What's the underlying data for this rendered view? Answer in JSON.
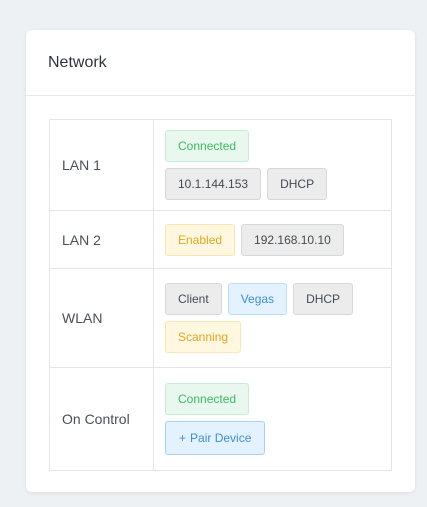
{
  "card": {
    "title": "Network"
  },
  "rows": [
    {
      "label": "LAN 1",
      "tags": [
        {
          "text": "Connected",
          "style": "success"
        },
        {
          "text": "10.1.144.153",
          "style": "default"
        },
        {
          "text": "DHCP",
          "style": "default"
        }
      ]
    },
    {
      "label": "LAN 2",
      "tags": [
        {
          "text": "Enabled",
          "style": "warning"
        },
        {
          "text": "192.168.10.10",
          "style": "default"
        }
      ]
    },
    {
      "label": "WLAN",
      "tags": [
        {
          "text": "Client",
          "style": "default"
        },
        {
          "text": "Vegas",
          "style": "info"
        },
        {
          "text": "DHCP",
          "style": "default"
        },
        {
          "text": "Scanning",
          "style": "warning"
        }
      ]
    },
    {
      "label": "On Control",
      "tags": [
        {
          "text": "Connected",
          "style": "success"
        }
      ],
      "button": {
        "icon": "+",
        "label": "Pair Device"
      }
    }
  ],
  "colors": {
    "success": "#3fb861",
    "warning": "#e3a622",
    "info": "#3d8fd8",
    "page_background": "#eef1f4"
  }
}
